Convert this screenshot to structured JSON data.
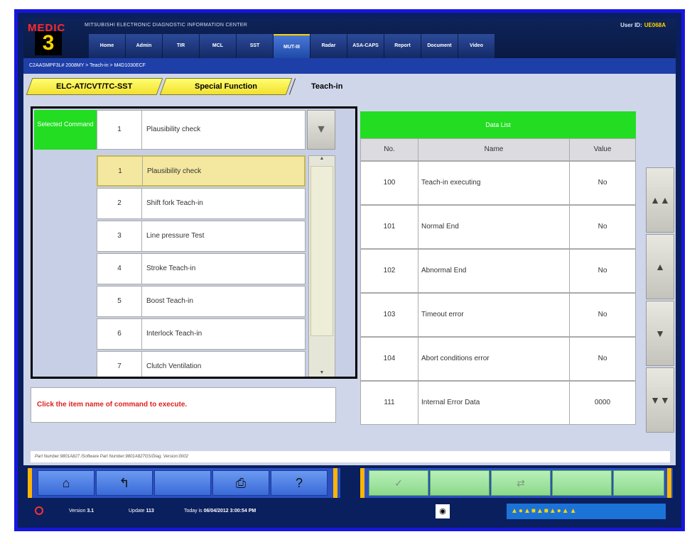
{
  "header": {
    "logo_top": "MEDIC",
    "logo_number": "3",
    "app_title": "MITSUBISHI ELECTRONIC DIAGNOSTIC INFORMATION CENTER",
    "user_id_label": "User ID:",
    "user_id_value": "UE068A",
    "tabs": [
      {
        "label": "Home"
      },
      {
        "label": "Admin"
      },
      {
        "label": "TIR"
      },
      {
        "label": "MCL"
      },
      {
        "label": "SST"
      },
      {
        "label": "MUT-III"
      },
      {
        "label": "Radar"
      },
      {
        "label": "ASA-CAPS"
      },
      {
        "label": "Report"
      },
      {
        "label": "Document"
      },
      {
        "label": "Video"
      }
    ],
    "active_tab": "MUT-III"
  },
  "breadcrumb": "C2AASMPF3L# 2008MY  >  Teach-in  >  M4D1030ECF",
  "subtabs": {
    "tab1": "ELC-AT/CVT/TC-SST",
    "tab2": "Special Function",
    "tab3": "Teach-in"
  },
  "command": {
    "selected_label": "Selected Command",
    "selected_num": "1",
    "selected_name": "Plausibility check",
    "dropdown_icon": "▼",
    "items": [
      {
        "num": "1",
        "name": "Plausibility check"
      },
      {
        "num": "2",
        "name": "Shift fork Teach-in"
      },
      {
        "num": "3",
        "name": "Line pressure Test"
      },
      {
        "num": "4",
        "name": "Stroke Teach-in"
      },
      {
        "num": "5",
        "name": "Boost Teach-in"
      },
      {
        "num": "6",
        "name": "Interlock Teach-in"
      },
      {
        "num": "7",
        "name": "Clutch Ventilation"
      }
    ]
  },
  "message": "Click the item name of command to execute.",
  "data_list": {
    "title": "Data List",
    "col_no": "No.",
    "col_name": "Name",
    "col_value": "Value",
    "rows": [
      {
        "no": "100",
        "name": "Teach-in executing",
        "value": "No"
      },
      {
        "no": "101",
        "name": "Normal End",
        "value": "No"
      },
      {
        "no": "102",
        "name": "Abnormal End",
        "value": "No"
      },
      {
        "no": "103",
        "name": "Timeout error",
        "value": "No"
      },
      {
        "no": "104",
        "name": "Abort conditions error",
        "value": "No"
      },
      {
        "no": "111",
        "name": "Internal Error Data",
        "value": "0000"
      }
    ]
  },
  "scroll_buttons": {
    "top": "▲▲",
    "up": "▲",
    "down": "▼",
    "bottom": "▼▼"
  },
  "part_info": "Part Number:9801A827  /Software Part Number:9801A827GS/Diag. Version:0002",
  "toolbar": {
    "home_icon": "⌂",
    "back_icon": "↰",
    "print_icon": "⎙",
    "help_label": "?",
    "check_icon": "✓",
    "swap_icon": "⇄"
  },
  "status": {
    "version_label": "Version",
    "version_value": "3.1",
    "update_label": "Update",
    "update_value": "113",
    "today_label": "Today is",
    "today_value": "06/04/2012 3:00:54 PM",
    "camera_icon": "◉",
    "tray": "▲●▲■▲■▲●▲▲"
  }
}
